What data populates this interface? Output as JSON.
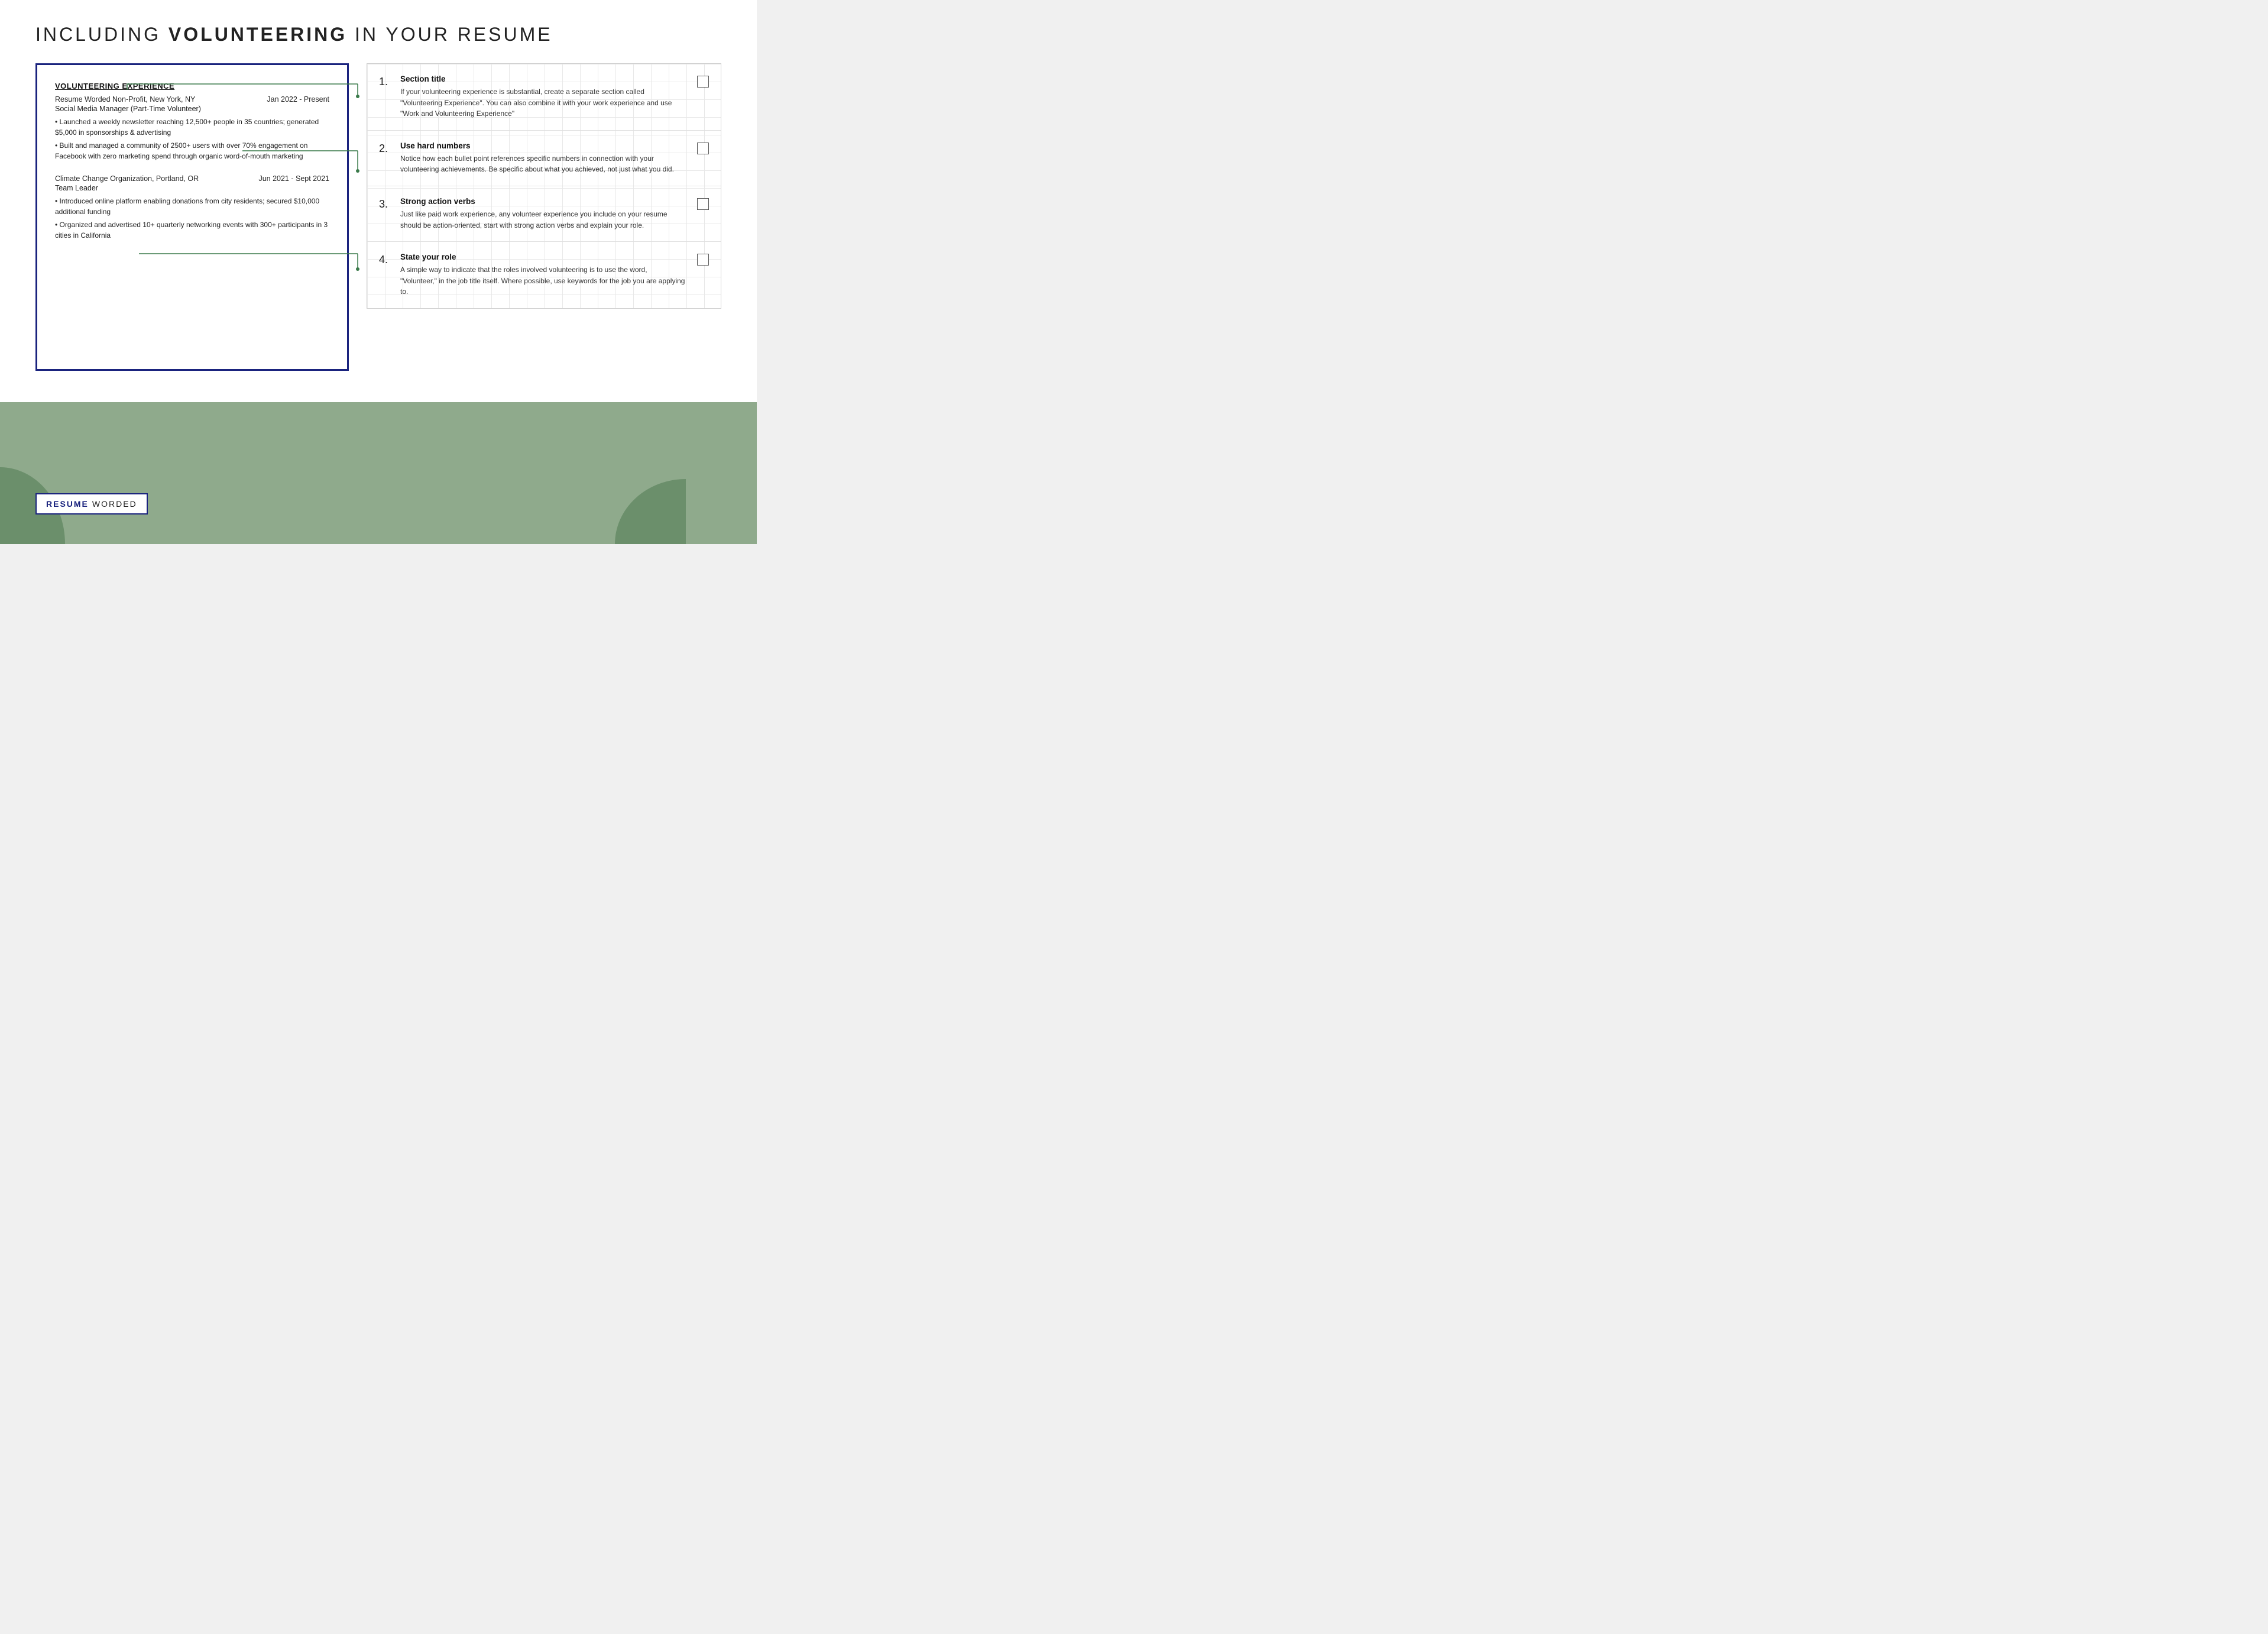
{
  "page": {
    "title_part1": "INCLUDING ",
    "title_bold": "VOLUNTEERING",
    "title_part2": " IN YOUR RESUME"
  },
  "resume": {
    "section_title": "VOLUNTEERING EXPERIENCE",
    "entries": [
      {
        "org": "Resume Worded Non-Profit, New York, NY",
        "dates": "Jan 2022 - Present",
        "role": "Social Media Manager (Part-Time Volunteer)",
        "bullets": [
          "• Launched a weekly newsletter reaching 12,500+ people in 35 countries; generated $5,000 in sponsorships & advertising",
          "• Built and managed a community of 2500+ users with over 70% engagement on Facebook with zero marketing spend through organic word-of-mouth marketing"
        ]
      },
      {
        "org": "Climate Change Organization, Portland, OR",
        "dates": "Jun 2021 - Sept 2021",
        "role": "Team Leader",
        "bullets": [
          "• Introduced online platform enabling donations from city residents; secured $10,000 additional funding",
          "• Organized and advertised 10+ quarterly networking events with 300+ participants in 3 cities in California"
        ]
      }
    ]
  },
  "tips": [
    {
      "number": "1.",
      "title": "Section title",
      "description": "If your volunteering experience is substantial, create a separate section called \"Volunteering Experience\". You can also combine it with your work experience and use \"Work and Volunteering Experience\""
    },
    {
      "number": "2.",
      "title": "Use hard numbers",
      "description": "Notice how each bullet point references specific numbers in connection with your volunteering achievements. Be specific about what you achieved, not just what you did."
    },
    {
      "number": "3.",
      "title": "Strong action verbs",
      "description": "Just like paid work experience, any volunteer experience you include on your resume should be action-oriented, start with strong action verbs and explain your role."
    },
    {
      "number": "4.",
      "title": "State your role",
      "description": "A simple way to indicate that the roles involved volunteering is to use the word, \"Volunteer,\" in the job title itself. Where possible, use keywords for the job you are applying to."
    }
  ],
  "brand": {
    "resume": "RESUME",
    "worded": "WORDED"
  },
  "colors": {
    "dark_blue": "#1a237e",
    "green": "#3a7a4a",
    "sage_green": "#8faa8c"
  }
}
